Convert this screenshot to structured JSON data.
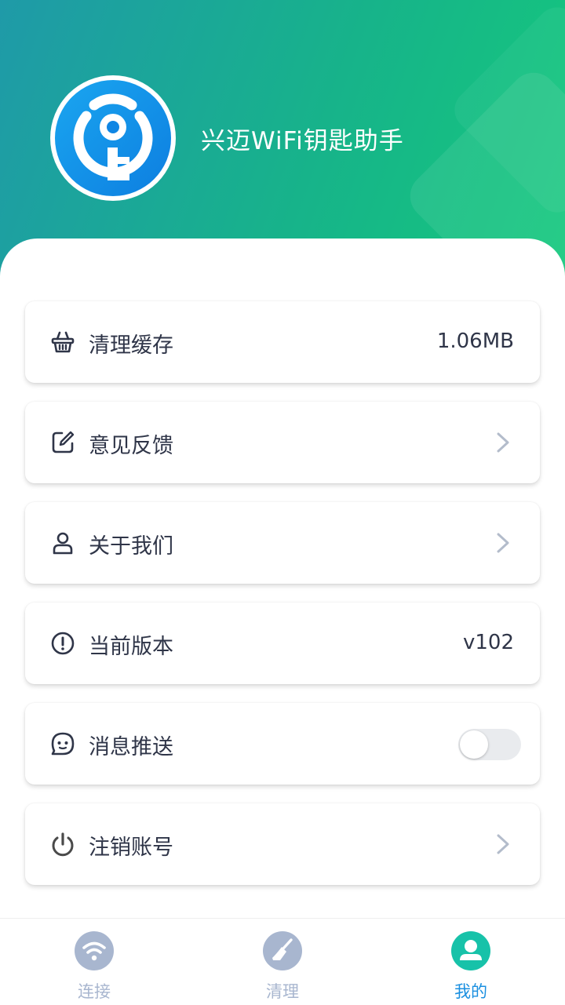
{
  "app": {
    "name": "兴迈WiFi钥匙助手"
  },
  "menu": [
    {
      "icon": "basket-icon",
      "label": "清理缓存",
      "value": "1.06MB"
    },
    {
      "icon": "edit-icon",
      "label": "意见反馈"
    },
    {
      "icon": "user-icon",
      "label": "关于我们"
    },
    {
      "icon": "info-icon",
      "label": "当前版本",
      "value": "v102"
    },
    {
      "icon": "chat-icon",
      "label": "消息推送",
      "toggle": false
    },
    {
      "icon": "power-icon",
      "label": "注销账号"
    }
  ],
  "tabs": [
    {
      "icon": "wifi-icon",
      "label": "连接",
      "active": false
    },
    {
      "icon": "broom-icon",
      "label": "清理",
      "active": false
    },
    {
      "icon": "profile-icon",
      "label": "我的",
      "active": true
    }
  ],
  "colors": {
    "accent": "#1a8fe0",
    "inactive": "#a8b6cf",
    "teal": "#17c2a9",
    "text": "#2f3548"
  }
}
